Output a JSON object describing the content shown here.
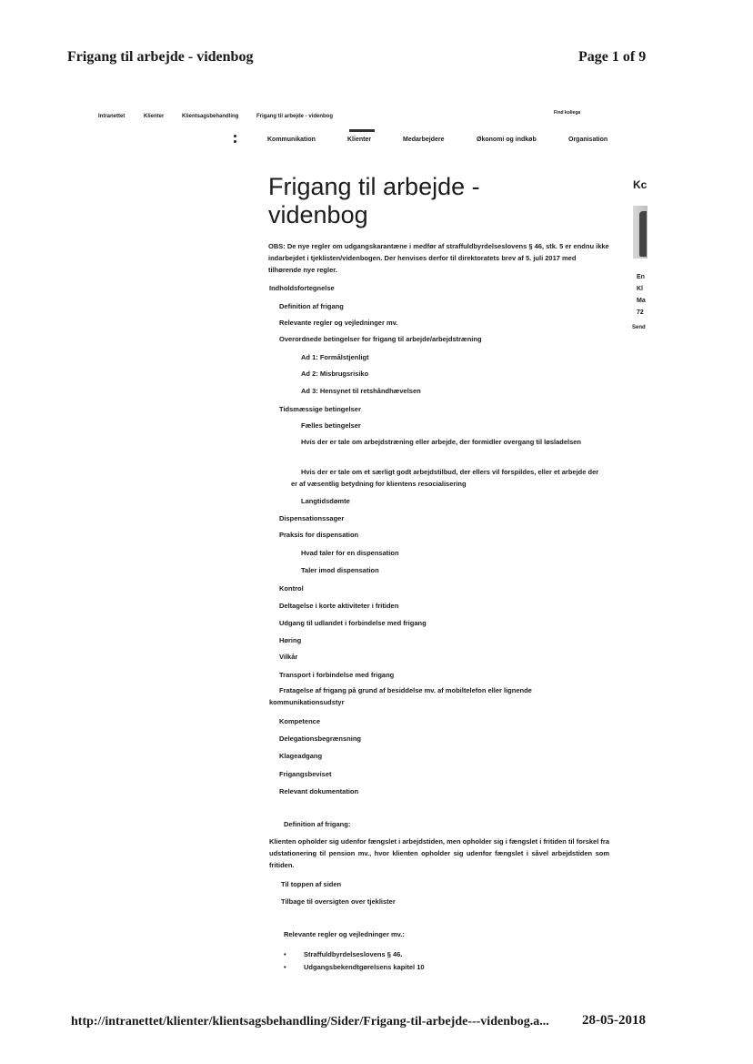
{
  "print_header": {
    "title": "Frigang til arbejde - videnbog",
    "page": "Page 1 of 9"
  },
  "print_footer": {
    "url": "http://intranettet/klienter/klientsagsbehandling/Sider/Frigang-til-arbejde---videnbog.a...",
    "date": "28-05-2018"
  },
  "breadcrumb": [
    "Intranettet",
    "Klienter",
    "Klientsagsbehandling",
    "Frigang til arbejde - videnbog"
  ],
  "find_link": "Find kollega",
  "nav": {
    "items": [
      "Kommunikation",
      "Klienter",
      "Medarbejdere",
      "Økonomi og indkøb",
      "Organisation"
    ],
    "active": "Klienter"
  },
  "page_title": "Frigang til arbejde - videnbog",
  "note": "OBS: De nye regler om udgangskarantæne i medfør af straffuldbyrdelseslovens § 46, stk. 5 er endnu ikke indarbejdet i tjeklisten/videnbogen. Der henvises derfor til direktoratets brev af 5. juli 2017 med tilhørende nye regler.",
  "toc_heading": "Indholdsfortegnelse",
  "toc": [
    {
      "text": "Definition af frigang"
    },
    {
      "text": "Relevante regler og vejledninger mv."
    },
    {
      "text": "Overordnede betingelser for frigang til arbejde/arbejdstræning"
    },
    {
      "text": "Ad 1: Formålstjenligt"
    },
    {
      "text": "Ad 2: Misbrugsrisiko"
    },
    {
      "text": "Ad 3: Hensynet til retshåndhævelsen"
    },
    {
      "text": "Tidsmæssige betingelser"
    },
    {
      "text": "Fælles betingelser"
    },
    {
      "text": "Hvis der er tale om arbejdstræning eller arbejde, der formidler overgang til løsladelsen"
    },
    {
      "text": "Hvis der er tale om et særligt godt arbejdstilbud, der ellers vil forspildes, eller et arbejde der er af væsentlig betydning for klientens resocialisering"
    },
    {
      "text": "Langtidsdømte"
    },
    {
      "text": "Dispensationssager"
    },
    {
      "text": "Praksis for dispensation"
    },
    {
      "text": "Hvad taler for en dispensation"
    },
    {
      "text": "Taler imod dispensation"
    },
    {
      "text": "Kontrol"
    },
    {
      "text": "Deltagelse i korte aktiviteter i fritiden"
    },
    {
      "text": "Udgang til udlandet i forbindelse med frigang"
    },
    {
      "text": "Høring"
    },
    {
      "text": "Vilkår"
    },
    {
      "text": "Transport i forbindelse med frigang"
    },
    {
      "text": "Fratagelse af frigang på grund af besiddelse mv. af mobiltelefon eller lignende kommunikationsudstyr"
    },
    {
      "text": "Kompetence"
    },
    {
      "text": "Delegationsbegrænsning"
    },
    {
      "text": "Klageadgang"
    },
    {
      "text": "Frigangsbeviset"
    },
    {
      "text": "Relevant dokumentation"
    }
  ],
  "definition": {
    "heading": "Definition af frigang:",
    "body": "Klienten opholder sig udenfor fængslet i arbejdstiden, men opholder sig i fængslet i fritiden til forskel fra udstationering til pension mv., hvor klienten opholder sig udenfor fængslet i såvel arbejdstiden som fritiden.",
    "links": [
      "Til toppen af siden",
      "Tilbage til oversigten over tjeklister"
    ]
  },
  "rules": {
    "heading": "Relevante regler og vejledninger mv.:",
    "items": [
      "Straffuldbyrdelseslovens § 46.",
      "Udgangsbekendtgørelsens kapitel 10"
    ]
  },
  "sidebar": {
    "heading": "Kc",
    "lines": [
      "En",
      "Kl",
      "Ma",
      "72"
    ],
    "send": "Send"
  }
}
